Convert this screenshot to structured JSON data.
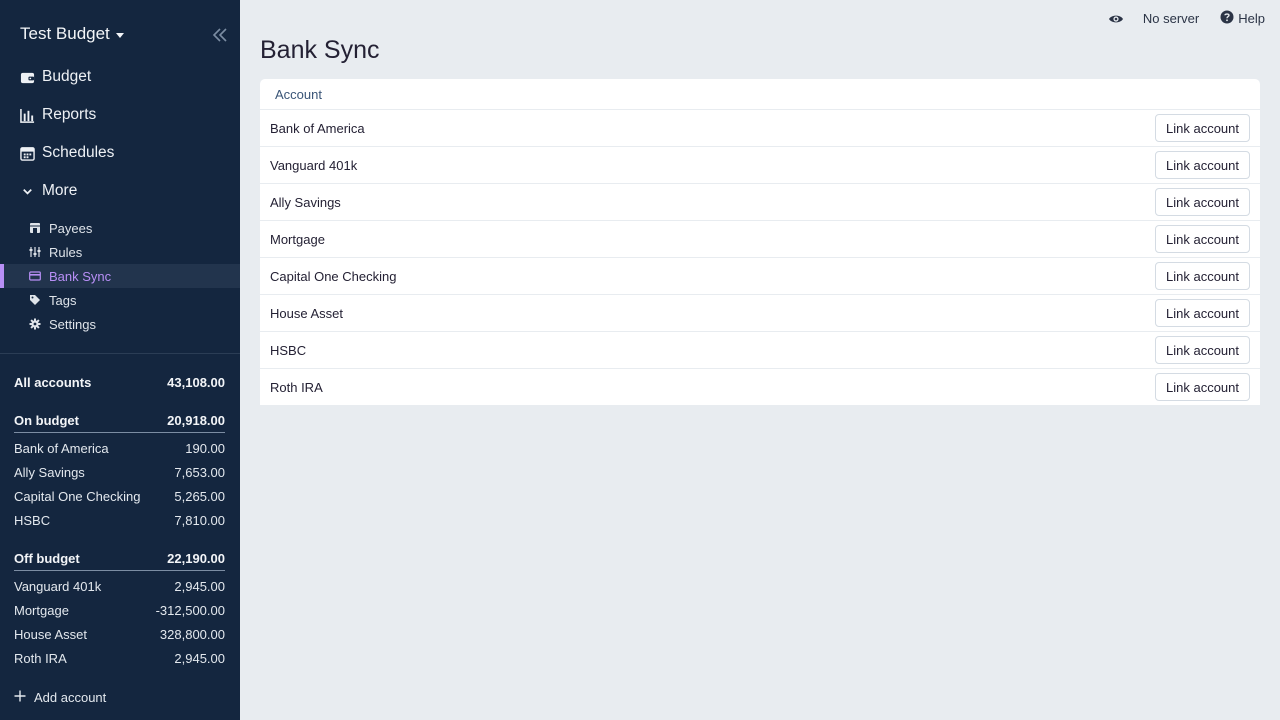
{
  "sidebar": {
    "budget_name": "Test Budget",
    "nav": [
      {
        "label": "Budget",
        "icon": "wallet-icon"
      },
      {
        "label": "Reports",
        "icon": "bar-chart-icon"
      },
      {
        "label": "Schedules",
        "icon": "calendar-icon"
      },
      {
        "label": "More",
        "icon": "chevron-down-icon"
      }
    ],
    "sub_nav": [
      {
        "label": "Payees",
        "icon": "store-icon"
      },
      {
        "label": "Rules",
        "icon": "sliders-icon"
      },
      {
        "label": "Bank Sync",
        "icon": "credit-card-icon",
        "active": true
      },
      {
        "label": "Tags",
        "icon": "tag-icon"
      },
      {
        "label": "Settings",
        "icon": "gear-icon"
      }
    ],
    "accounts": {
      "all": {
        "label": "All accounts",
        "amount": "43,108.00"
      },
      "on_budget": {
        "label": "On budget",
        "amount": "20,918.00",
        "items": [
          {
            "name": "Bank of America",
            "amount": "190.00"
          },
          {
            "name": "Ally Savings",
            "amount": "7,653.00"
          },
          {
            "name": "Capital One Checking",
            "amount": "5,265.00"
          },
          {
            "name": "HSBC",
            "amount": "7,810.00"
          }
        ]
      },
      "off_budget": {
        "label": "Off budget",
        "amount": "22,190.00",
        "items": [
          {
            "name": "Vanguard 401k",
            "amount": "2,945.00"
          },
          {
            "name": "Mortgage",
            "amount": "-312,500.00"
          },
          {
            "name": "House Asset",
            "amount": "328,800.00"
          },
          {
            "name": "Roth IRA",
            "amount": "2,945.00"
          }
        ]
      }
    },
    "add_account": "Add account"
  },
  "topbar": {
    "server_status": "No server",
    "help": "Help"
  },
  "main": {
    "title": "Bank Sync",
    "column_header": "Account",
    "button_label": "Link account",
    "rows": [
      "Bank of America",
      "Vanguard 401k",
      "Ally Savings",
      "Mortgage",
      "Capital One Checking",
      "House Asset",
      "HSBC",
      "Roth IRA"
    ]
  },
  "colors": {
    "sidebar_bg": "#14263f",
    "accent": "#b88ff6",
    "page_bg": "#e8ecf0"
  }
}
